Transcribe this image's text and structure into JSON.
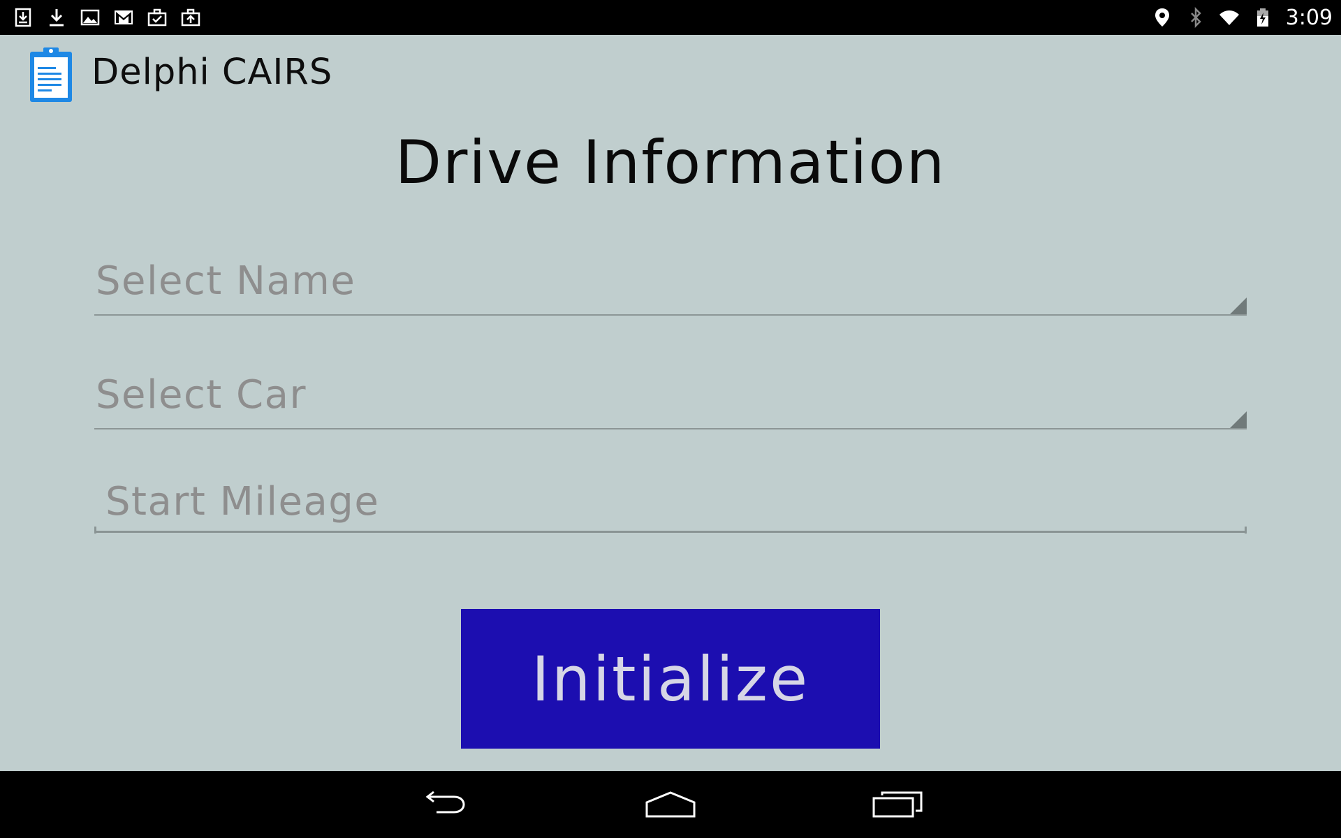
{
  "status_bar": {
    "time": "3:09",
    "left_icons": [
      "download-box-icon",
      "download-icon",
      "image-icon",
      "gmail-icon",
      "briefcase-check-icon",
      "briefcase-upload-icon"
    ],
    "right_icons": [
      "location-icon",
      "bluetooth-icon",
      "wifi-icon",
      "battery-icon"
    ]
  },
  "action_bar": {
    "title": "Delphi CAIRS",
    "app_icon": "clipboard-icon",
    "icon_color": "#1e88e5"
  },
  "form": {
    "heading": "Drive Information",
    "name_spinner": {
      "hint": "Select Name"
    },
    "car_spinner": {
      "hint": "Select Car"
    },
    "mileage_input": {
      "placeholder": "Start Mileage",
      "value": ""
    },
    "submit_label": "Initialize"
  },
  "colors": {
    "background": "#c0cece",
    "button_bg": "#1c0eb0",
    "button_text": "#d6d6e6"
  },
  "nav_bar": {
    "buttons": [
      "back-icon",
      "home-icon",
      "recent-apps-icon"
    ]
  }
}
